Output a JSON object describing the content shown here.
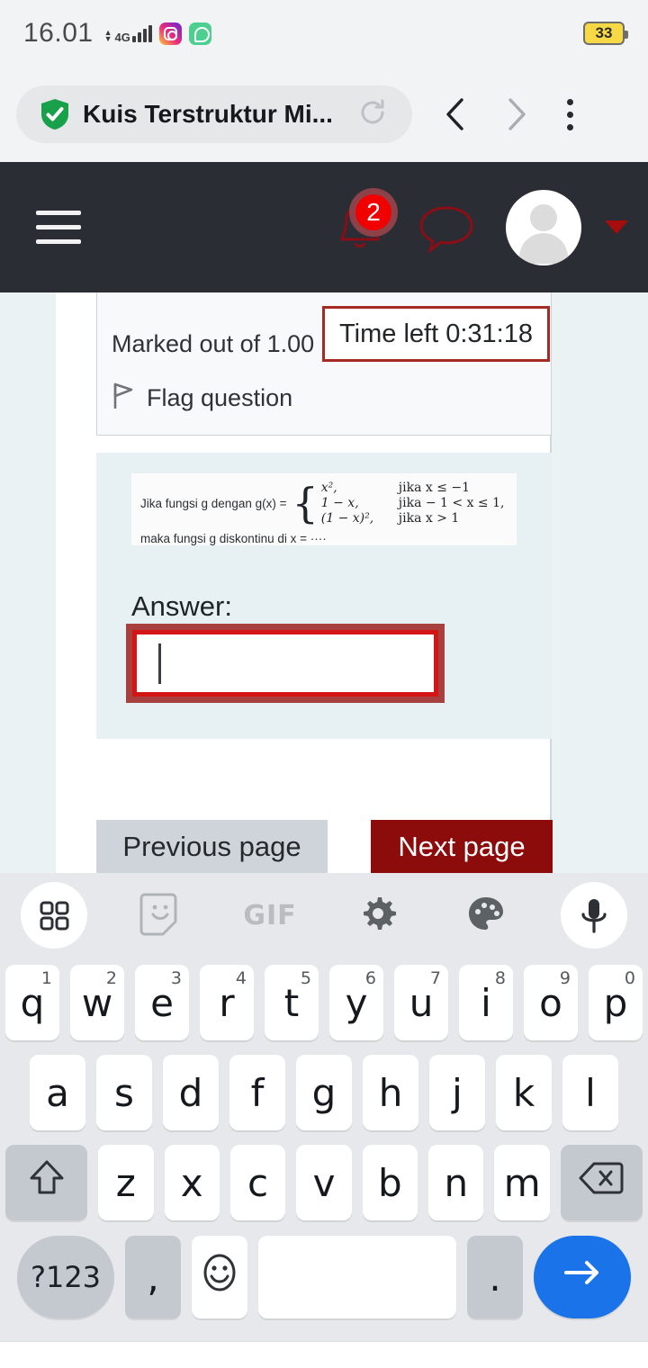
{
  "status_bar": {
    "time": "16.01",
    "network": "4G",
    "battery_level": "33",
    "icons": [
      "signal-bars-icon",
      "instagram-icon",
      "whatsapp-icon",
      "battery-icon"
    ]
  },
  "browser_bar": {
    "security_icon": "shield-check-icon",
    "page_title": "Kuis Terstruktur Mi...",
    "reload_icon": "reload-icon",
    "back_icon": "chevron-left-icon",
    "forward_icon": "chevron-right-icon",
    "menu_icon": "overflow-menu-icon"
  },
  "site_nav": {
    "menu_icon": "hamburger-menu-icon",
    "notifications": {
      "icon": "bell-icon",
      "badge_count": "2"
    },
    "messages_icon": "chat-bubble-icon",
    "avatar_icon": "user-avatar-icon",
    "dropdown_icon": "caret-down-icon",
    "background": "#2a2d34"
  },
  "question": {
    "marked_out_of": "Marked out of 1.00",
    "flag_label": "Flag question",
    "flag_icon": "flag-icon",
    "timer_label": "Time left 0:31:18",
    "timer_border_color": "#a62a24",
    "image_text": {
      "lead": "Jika fungsi g dengan g(x) =",
      "case1_expr": "x²,",
      "case1_cond": "jika x ≤ −1",
      "case2_expr": "1 − x,",
      "case2_cond": "jika − 1 < x ≤ 1,",
      "case3_expr": "(1 − x)²,",
      "case3_cond": "jika x > 1",
      "closing": "maka fungsi g diskontinu di x = ····"
    },
    "answer_label": "Answer:",
    "answer_value": "",
    "answer_placeholder": "",
    "answer_border_color": "#d31515"
  },
  "pagination": {
    "previous_label": "Previous page",
    "next_label": "Next page",
    "next_color": "#8c0b0b"
  },
  "keyboard": {
    "toolbar": [
      {
        "name": "grid-apps-icon",
        "label": ""
      },
      {
        "name": "sticker-icon",
        "label": ""
      },
      {
        "name": "gif-icon",
        "label": "GIF"
      },
      {
        "name": "gear-icon",
        "label": ""
      },
      {
        "name": "palette-icon",
        "label": ""
      },
      {
        "name": "microphone-icon",
        "label": ""
      }
    ],
    "row1": [
      {
        "key": "q",
        "num": "1"
      },
      {
        "key": "w",
        "num": "2"
      },
      {
        "key": "e",
        "num": "3"
      },
      {
        "key": "r",
        "num": "4"
      },
      {
        "key": "t",
        "num": "5"
      },
      {
        "key": "y",
        "num": "6"
      },
      {
        "key": "u",
        "num": "7"
      },
      {
        "key": "i",
        "num": "8"
      },
      {
        "key": "o",
        "num": "9"
      },
      {
        "key": "p",
        "num": "0"
      }
    ],
    "row2": [
      "a",
      "s",
      "d",
      "f",
      "g",
      "h",
      "j",
      "k",
      "l"
    ],
    "row3": [
      "z",
      "x",
      "c",
      "v",
      "b",
      "n",
      "m"
    ],
    "shift_icon": "shift-icon",
    "backspace_icon": "backspace-icon",
    "row4": {
      "symbols_label": "?123",
      "comma_label": ",",
      "emoji_icon": "emoji-icon",
      "space_label": "",
      "period_label": ".",
      "enter_icon": "arrow-right-icon",
      "enter_color": "#1a73e8"
    }
  }
}
